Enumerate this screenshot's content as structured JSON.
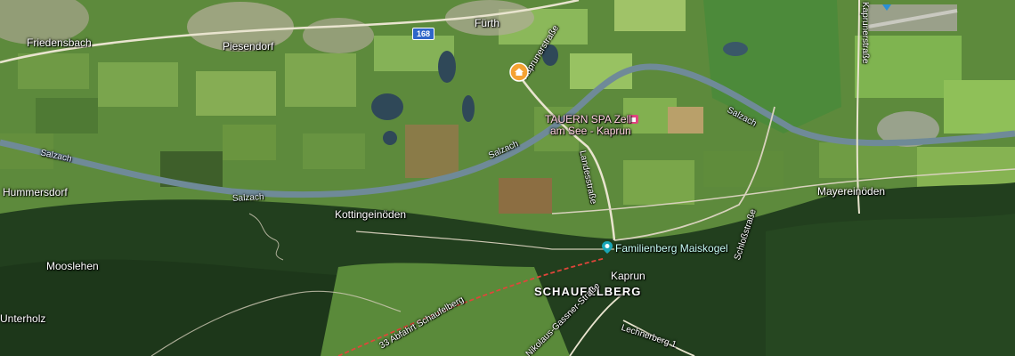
{
  "map": {
    "places": {
      "friedensbach": "Friedensbach",
      "piesendorf": "Piesendorf",
      "furth": "Fürth",
      "hummersdorf": "Hummersdorf",
      "kottingeinoden": "Kottingeinöden",
      "mooslehen": "Mooslehen",
      "unterholz": "Unterholz",
      "schaufelberg": "SCHAUFELBERG",
      "kaprun": "Kaprun",
      "mayereinoden": "Mayereinöden"
    },
    "water": {
      "salzach_1": "Salzach",
      "salzach_2": "Salzach",
      "salzach_3": "Salzach",
      "salzach_4": "Salzach"
    },
    "roads": {
      "route_168": "168",
      "kaprunerstrasse_top": "Kaprunerstraße",
      "kaprunerstrasse": "Kaprunerstraße",
      "landesstrasse": "Landesstraße",
      "schlossstrasse": "Schloßstraße",
      "abfahrt": "33 Abfahrt Schaufelberg",
      "nikolaus": "Nikolaus-Gassner-Straße",
      "lechnerberg": "Lechnerberg 1"
    },
    "pois": {
      "tauern_spa_line1": "TAUERN SPA Zell",
      "tauern_spa_line2": "am See - Kaprun",
      "familienberg": "Familienberg Maiskogel"
    },
    "colors": {
      "accent_home_pin": "#f4a233",
      "spa_pin": "#e0457f",
      "family_pin": "#1aa6b7",
      "route_shield": "#2f66c9",
      "cable_car": "#e0453a",
      "river": "#6f8a98",
      "road": "#e9e4cf"
    },
    "icons": [
      "home-icon",
      "spa-icon",
      "family-icon",
      "airport-icon"
    ]
  }
}
